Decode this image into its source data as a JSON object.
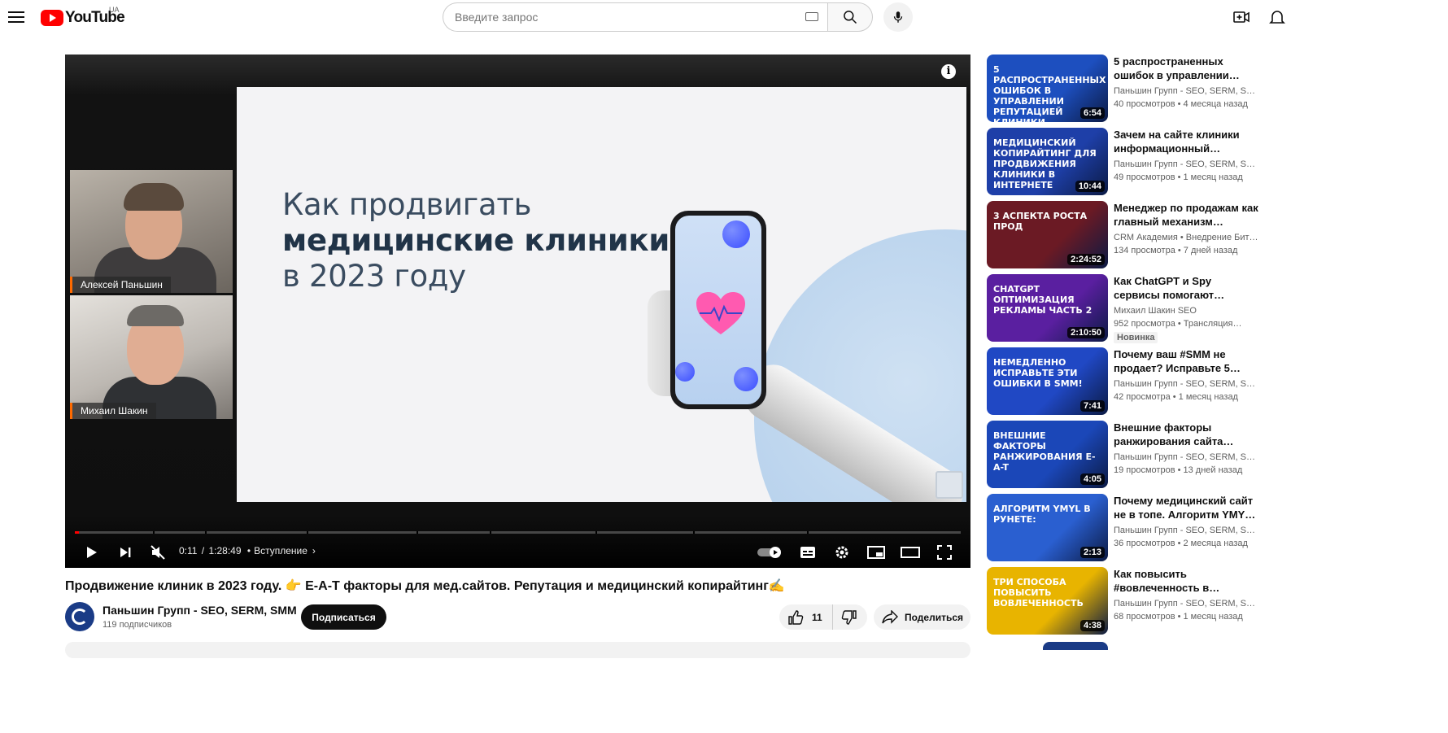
{
  "header": {
    "logo_text": "YouTube",
    "country": "UA",
    "search_placeholder": "Введите запрос"
  },
  "player": {
    "slide_line1": "Как продвигать",
    "slide_line2": "медицинские клиники",
    "slide_line3": "в 2023 году",
    "cam1_name": "Алексей Паньшин",
    "cam2_name": "Михаил Шакин",
    "current_time": "0:11",
    "duration": "1:28:49",
    "chapter": "Вступление",
    "progress_fraction": 0.002,
    "accent": "#ff0000"
  },
  "video": {
    "title": "Продвижение клиник в 2023 году. 👉 E-A-T факторы для мед.сайтов. Репутация и медицинский копирайтинг✍️",
    "channel": "Паньшин Групп - SEO, SERM, SMM",
    "subscribers": "119 подписчиков",
    "subscribe_label": "Подписаться",
    "likes": "11",
    "share_label": "Поделиться"
  },
  "recommendations": [
    {
      "title": "5 распространенных ошибок в управлении репутацией…",
      "channel": "Паньшин Групп - SEO, SERM, SMM",
      "meta": "40 просмотров • 4 месяца назад",
      "duration": "6:54",
      "thumb_text": "5 распространенных ошибок в управлении репутацией клиники",
      "bg": "#1d4fbf"
    },
    {
      "title": "Зачем на сайте клиники информационный контент.…",
      "channel": "Паньшин Групп - SEO, SERM, SMM",
      "meta": "49 просмотров • 1 месяц назад",
      "duration": "10:44",
      "thumb_text": "Медицинский копирайтинг для продвижения клиники в интернете",
      "bg": "#1e3fa8"
    },
    {
      "title": "Менеджер по продажам как главный механизм…",
      "channel": "CRM Академия • Внедрение Битри…",
      "meta": "134 просмотра • 7 дней назад",
      "duration": "2:24:52",
      "thumb_text": "3 аспекта роста прод",
      "bg": "#6b1a24"
    },
    {
      "title": "Как ChatGPT и Spy сервисы помогают оптимизировать…",
      "channel": "Михаил Шакин SEO",
      "meta": "952 просмотра • Трансляция…",
      "duration": "2:10:50",
      "thumb_text": "ChatGPT оптимизация рекламы часть 2",
      "bg": "#5a1fa0",
      "badge": "Новинка"
    },
    {
      "title": "Почему ваш #SMM не продает? Исправьте 5 ошибо…",
      "channel": "Паньшин Групп - SEO, SERM, SMM",
      "meta": "42 просмотра • 1 месяц назад",
      "duration": "7:41",
      "thumb_text": "Немедленно исправьте эти ошибки в SMM!",
      "bg": "#2048c4"
    },
    {
      "title": "Внешние факторы ранжирования сайта…",
      "channel": "Паньшин Групп - SEO, SERM, SMM",
      "meta": "19 просмотров • 13 дней назад",
      "duration": "4:05",
      "thumb_text": "Внешние факторы ранжирования E-A-T",
      "bg": "#1b47b8"
    },
    {
      "title": "Почему медицинский сайт не в топе. Алгоритм YMYL в…",
      "channel": "Паньшин Групп - SEO, SERM, SMM",
      "meta": "36 просмотров • 2 месяца назад",
      "duration": "2:13",
      "thumb_text": "Алгоритм YMYL в Рунете:",
      "bg": "#2a5fd0"
    },
    {
      "title": "Как повысить #вовлеченность в…",
      "channel": "Паньшин Групп - SEO, SERM, SMM",
      "meta": "68 просмотров • 1 месяц назад",
      "duration": "4:38",
      "thumb_text": "Три способа повысить вовлеченность",
      "bg": "#e8b400"
    }
  ]
}
